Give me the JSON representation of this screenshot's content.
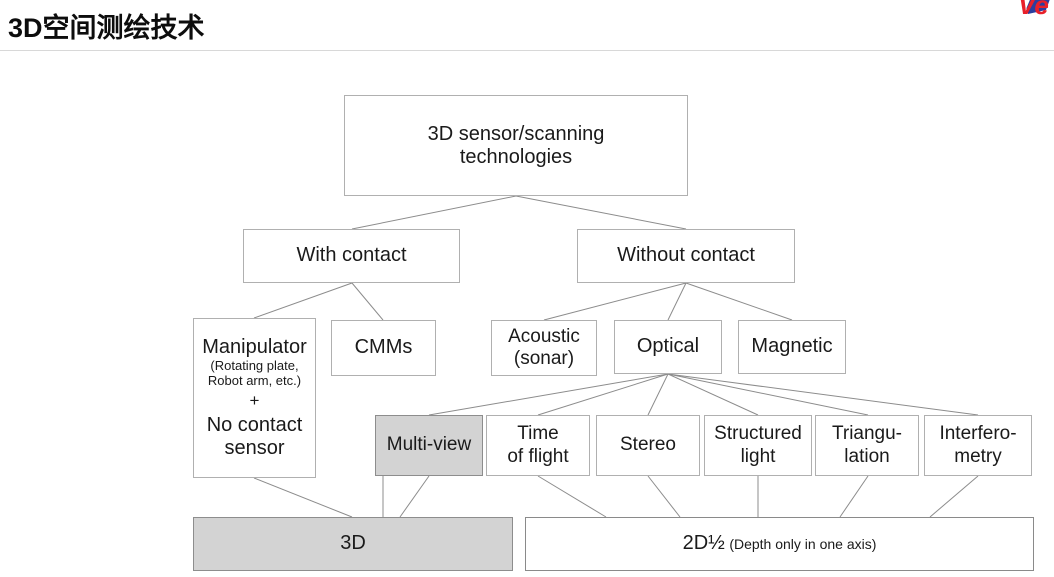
{
  "header": {
    "title": "3D空间测绘技术",
    "logo": {
      "name": "vention-logo",
      "text": "Ve",
      "red": "#e8202a",
      "blue": "#2b3e9e"
    },
    "divider_color": "#d8d8d8"
  },
  "diagram": {
    "type": "tree",
    "colors": {
      "box_border": "#b0b0b0",
      "box_fill": "#ffffff",
      "shaded_fill": "#d3d3d3",
      "shaded_border": "#8d8d8d",
      "edge": "#8c8c8c",
      "text": "#1a1a1a"
    },
    "nodes": {
      "root": {
        "id": "root",
        "line1": "3D sensor/scanning",
        "line2": "technologies",
        "shaded": false
      },
      "with_contact": {
        "id": "with-contact",
        "label": "With contact",
        "shaded": false
      },
      "without_contact": {
        "id": "without-contact",
        "label": "Without contact",
        "shaded": false
      },
      "manipulator": {
        "id": "manipulator",
        "title": "Manipulator",
        "detail1": "(Rotating plate,",
        "detail2": "Robot arm, etc.)",
        "plus": "+",
        "tail1": "No contact",
        "tail2": "sensor",
        "shaded": false
      },
      "cmms": {
        "id": "cmms",
        "label": "CMMs",
        "shaded": false
      },
      "acoustic": {
        "id": "acoustic",
        "line1": "Acoustic",
        "line2": "(sonar)",
        "shaded": false
      },
      "optical": {
        "id": "optical",
        "label": "Optical",
        "shaded": false
      },
      "magnetic": {
        "id": "magnetic",
        "label": "Magnetic",
        "shaded": false
      },
      "multi_view": {
        "id": "multi-view",
        "label": "Multi-view",
        "shaded": true
      },
      "time_of_flight": {
        "id": "time-of-flight",
        "line1": "Time",
        "line2": "of flight",
        "shaded": false
      },
      "stereo": {
        "id": "stereo",
        "label": "Stereo",
        "shaded": false
      },
      "structured_light": {
        "id": "structured-light",
        "line1": "Structured",
        "line2": "light",
        "shaded": false
      },
      "triangulation": {
        "id": "triangulation",
        "line1": "Triangu-",
        "line2": "lation",
        "shaded": false
      },
      "interferometry": {
        "id": "interferometry",
        "line1": "Interfero-",
        "line2": "metry",
        "shaded": false
      },
      "result_3d": {
        "id": "result-3d",
        "label": "3D",
        "shaded": true
      },
      "result_2d_half": {
        "id": "result-2d-half",
        "label": "2D½",
        "note": "(Depth only in one axis)",
        "shaded": false
      }
    },
    "edges": [
      {
        "from": "root",
        "to": "with_contact"
      },
      {
        "from": "root",
        "to": "without_contact"
      },
      {
        "from": "with_contact",
        "to": "manipulator"
      },
      {
        "from": "with_contact",
        "to": "cmms"
      },
      {
        "from": "without_contact",
        "to": "acoustic"
      },
      {
        "from": "without_contact",
        "to": "optical"
      },
      {
        "from": "without_contact",
        "to": "magnetic"
      },
      {
        "from": "optical",
        "to": "multi_view"
      },
      {
        "from": "optical",
        "to": "time_of_flight"
      },
      {
        "from": "optical",
        "to": "stereo"
      },
      {
        "from": "optical",
        "to": "structured_light"
      },
      {
        "from": "optical",
        "to": "triangulation"
      },
      {
        "from": "optical",
        "to": "interferometry"
      },
      {
        "from": "manipulator",
        "to": "result_3d"
      },
      {
        "from": "cmms",
        "to": "result_3d"
      },
      {
        "from": "multi_view",
        "to": "result_3d"
      },
      {
        "from": "time_of_flight",
        "to": "result_2d_half"
      },
      {
        "from": "stereo",
        "to": "result_2d_half"
      },
      {
        "from": "structured_light",
        "to": "result_2d_half"
      },
      {
        "from": "triangulation",
        "to": "result_2d_half"
      },
      {
        "from": "interferometry",
        "to": "result_2d_half"
      }
    ]
  }
}
